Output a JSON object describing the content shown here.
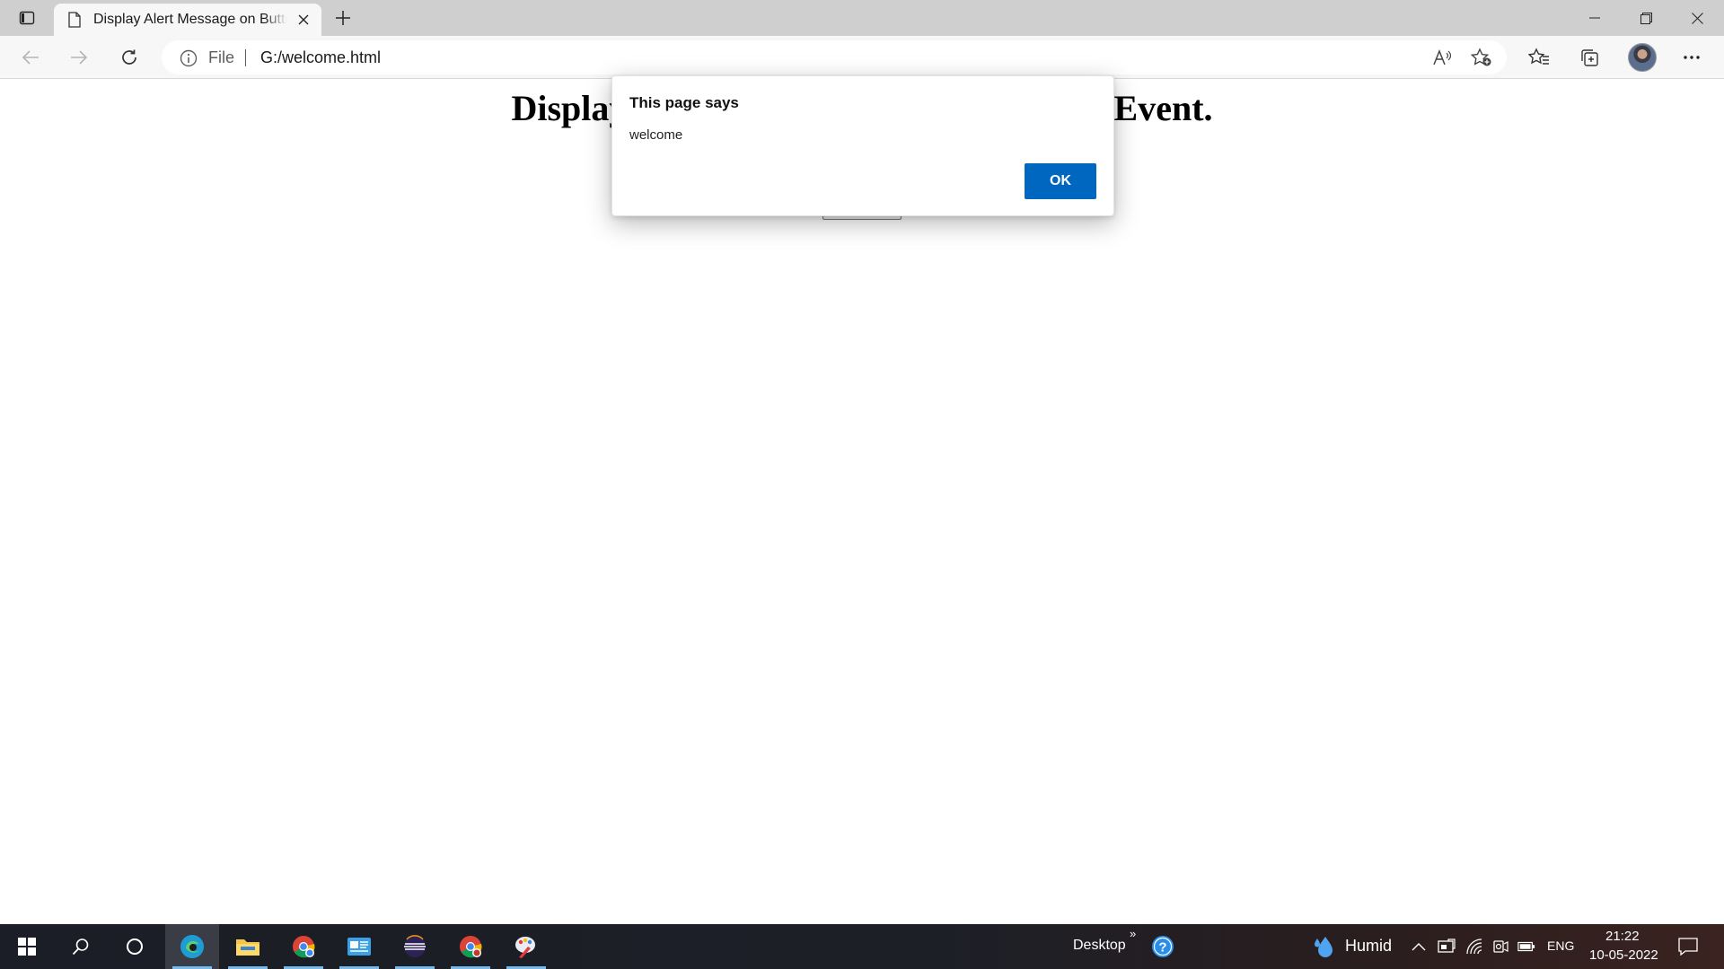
{
  "browser": {
    "tab": {
      "title": "Display Alert Message on Button Click Event."
    },
    "address_bar": {
      "scheme_label": "File",
      "url": "G:/welcome.html"
    }
  },
  "page": {
    "heading": "Display Alert Message on Button Click Event."
  },
  "dialog": {
    "title": "This page says",
    "message": "welcome",
    "ok_label": "OK"
  },
  "taskbar": {
    "desktop_label": "Desktop",
    "weather_label": "Humid",
    "language": "ENG",
    "time": "21:22",
    "date": "10-05-2022"
  },
  "colors": {
    "dialog_ok": "#0067c0",
    "taskbar_bg": "#1d1f27",
    "tab_strip": "#cfcfcf",
    "toolbar": "#f7f7f7"
  }
}
